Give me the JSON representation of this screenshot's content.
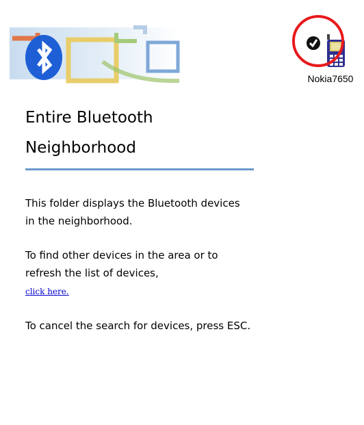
{
  "panel": {
    "title_line1": "Entire Bluetooth",
    "title_line2": "Neighborhood",
    "paragraphs": {
      "p1": "This folder displays the Bluetooth devices in the neighborhood.",
      "p2_before_link": "To find other devices in the area or to refresh the list of devices,",
      "p2_link": "click here.",
      "p3": "To cancel the search for devices, press ESC."
    }
  },
  "devices": [
    {
      "name": "Nokia7650",
      "icon": "mobile-phone-icon",
      "status_icon": "connected-check-icon"
    }
  ],
  "colors": {
    "divider": "#6a98cc",
    "link": "#0000cc",
    "highlight_ring": "#e8191c",
    "bluetooth_badge": "#1e5fd6"
  }
}
